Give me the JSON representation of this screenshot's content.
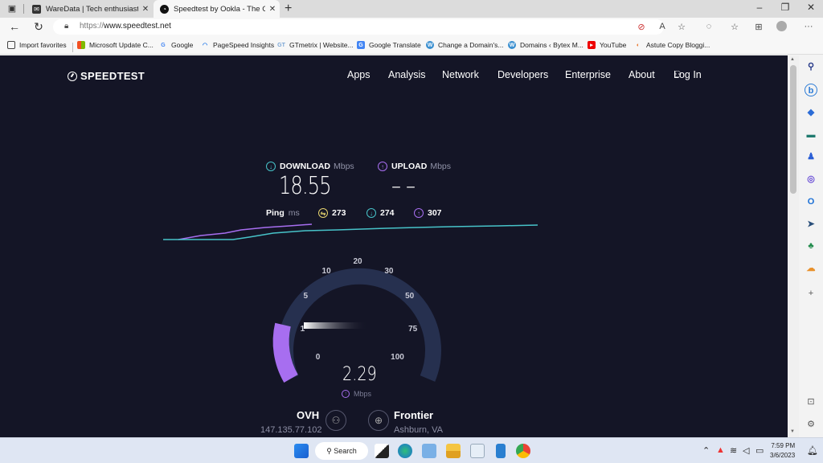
{
  "browser": {
    "tabs": [
      {
        "title": "WareData | Tech enthusiast",
        "icon": "waredata-favicon",
        "active": false
      },
      {
        "title": "Speedtest by Ookla - The Global",
        "icon": "speedtest-favicon",
        "active": true
      }
    ],
    "url_protocol": "https://",
    "url_host": "www.speedtest.net",
    "bookmarks": [
      {
        "label": "Import favorites",
        "icon": "import-icon"
      },
      {
        "label": "Microsoft Update C...",
        "icon": "microsoft-icon"
      },
      {
        "label": "Google",
        "icon": "google-icon"
      },
      {
        "label": "PageSpeed Insights",
        "icon": "pagespeed-icon"
      },
      {
        "label": "GTmetrix | Website...",
        "icon": "gtmetrix-icon"
      },
      {
        "label": "Google Translate",
        "icon": "translate-icon"
      },
      {
        "label": "Change a Domain's...",
        "icon": "wordpress-icon"
      },
      {
        "label": "Domains ‹ Bytex M...",
        "icon": "wordpress-icon"
      },
      {
        "label": "YouTube",
        "icon": "youtube-icon"
      },
      {
        "label": "Astute Copy Bloggi...",
        "icon": "astute-icon"
      }
    ]
  },
  "site": {
    "logo": "SPEEDTEST",
    "nav": [
      "Apps",
      "Analysis",
      "Network",
      "Developers",
      "Enterprise",
      "About"
    ],
    "login": "Log In"
  },
  "results": {
    "download_label": "DOWNLOAD",
    "download_unit": "Mbps",
    "download_value": "18.55",
    "upload_label": "UPLOAD",
    "upload_unit": "Mbps",
    "upload_value": "– –",
    "ping_label": "Ping",
    "ping_unit": "ms",
    "ping_idle": "273",
    "ping_download": "274",
    "ping_upload": "307"
  },
  "gauge": {
    "ticks": [
      "0",
      "1",
      "5",
      "10",
      "20",
      "30",
      "50",
      "75",
      "100"
    ],
    "current_value": "2.29",
    "current_unit": "Mbps",
    "colors": {
      "track": "#26304f",
      "fill": "#a76ef0",
      "download": "#47c3c9",
      "upload": "#a76ef0",
      "idle": "#e6d46e"
    }
  },
  "server": {
    "host": "OVH",
    "ip": "147.135.77.102",
    "isp": "Frontier",
    "location": "Ashburn, VA"
  },
  "taskbar": {
    "search_label": "Search",
    "time": "7:59 PM",
    "date": "3/6/2023"
  }
}
